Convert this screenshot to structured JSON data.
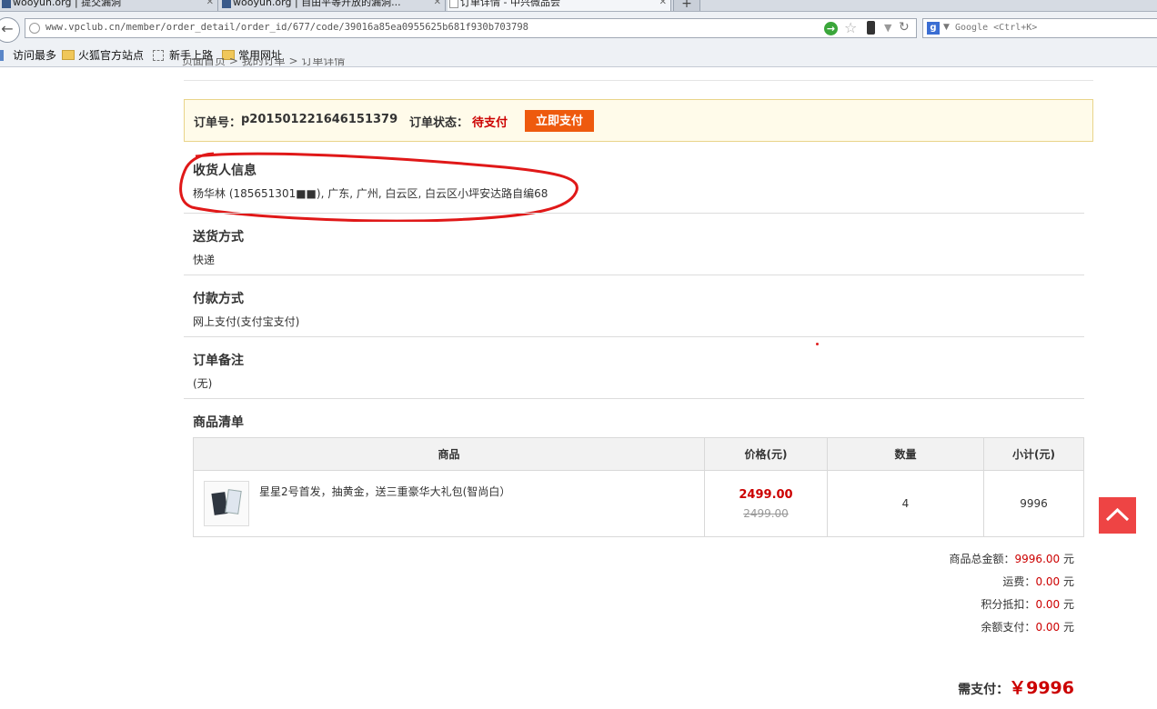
{
  "browser": {
    "tabs": [
      {
        "title": "wooyun.org | 提交漏洞"
      },
      {
        "title": "wooyun.org | 自由平等开放的漏洞..."
      },
      {
        "title": "订单详情 - 中兴微品会"
      }
    ],
    "new_tab_label": "+",
    "url": "www.vpclub.cn/member/order_detail/order_id/677/code/39016a85ea0955625b681f930b703798",
    "search_placeholder": "Google <Ctrl+K>",
    "search_engine_letter": "g",
    "bookmarks": [
      "访问最多",
      "火狐官方站点",
      "新手上路",
      "常用网址"
    ]
  },
  "page": {
    "breadcrumb": "页面首页 > 我的订单 > 订单详情",
    "order_number_label": "订单号：",
    "order_number": "p201501221646151379",
    "order_status_label": "订单状态：",
    "order_status": "待支付",
    "pay_button": "立即支付",
    "receiver": {
      "title": "收货人信息",
      "value": "杨华林 (185651301■■), 广东, 广州, 白云区, 白云区小坪安达路自编68"
    },
    "delivery": {
      "title": "送货方式",
      "value": "快递"
    },
    "payment": {
      "title": "付款方式",
      "value": "网上支付(支付宝支付)"
    },
    "remark": {
      "title": "订单备注",
      "value": "(无)"
    },
    "goods": {
      "title": "商品清单",
      "columns": [
        "商品",
        "价格(元)",
        "数量",
        "小计(元)"
      ],
      "rows": [
        {
          "name": "星星2号首发，抽黄金，送三重豪华大礼包(智尚白）",
          "price": "2499.00",
          "original_price": "2499.00",
          "quantity": "4",
          "subtotal": "9996"
        }
      ]
    },
    "totals": {
      "goods_total_label": "商品总金额：",
      "goods_total": "9996.00",
      "shipping_label": "运费：",
      "shipping": "0.00",
      "points_label": "积分抵扣：",
      "points": "0.00",
      "balance_label": "余额支付：",
      "balance": "0.00",
      "unit": "元",
      "due_label": "需支付：",
      "due": "￥9996"
    }
  },
  "colors": {
    "accent_red": "#cc0000",
    "pay_button": "#ee5a0e",
    "back_to_top": "#ee4444",
    "order_bar_bg": "#fffbea"
  }
}
